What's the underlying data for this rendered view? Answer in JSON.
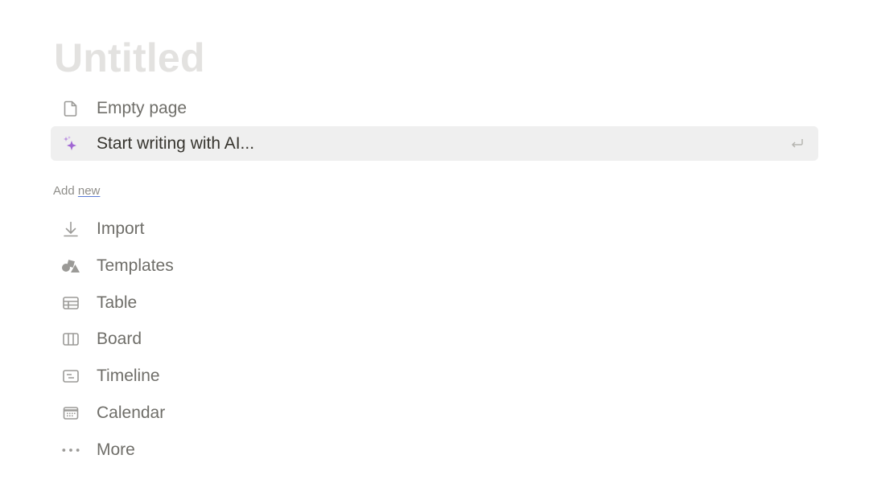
{
  "page": {
    "title": "Untitled"
  },
  "top_options": [
    {
      "label": "Empty page",
      "icon": "page-icon"
    },
    {
      "label": "Start writing with AI...",
      "icon": "sparkle-icon",
      "shortcut_icon": "enter-key-icon"
    }
  ],
  "section": {
    "prefix": "Add",
    "link": "new"
  },
  "add_items": [
    {
      "label": "Import",
      "icon": "download-arrow-icon"
    },
    {
      "label": "Templates",
      "icon": "shapes-icon"
    },
    {
      "label": "Table",
      "icon": "table-icon"
    },
    {
      "label": "Board",
      "icon": "board-icon"
    },
    {
      "label": "Timeline",
      "icon": "timeline-icon"
    },
    {
      "label": "Calendar",
      "icon": "calendar-icon"
    },
    {
      "label": "More",
      "icon": "more-dots-icon"
    }
  ],
  "colors": {
    "title_placeholder": "#e3e2e0",
    "hover_background": "#efefef",
    "ai_accent": "#a066d3",
    "link_underline": "#5b7bd5"
  }
}
